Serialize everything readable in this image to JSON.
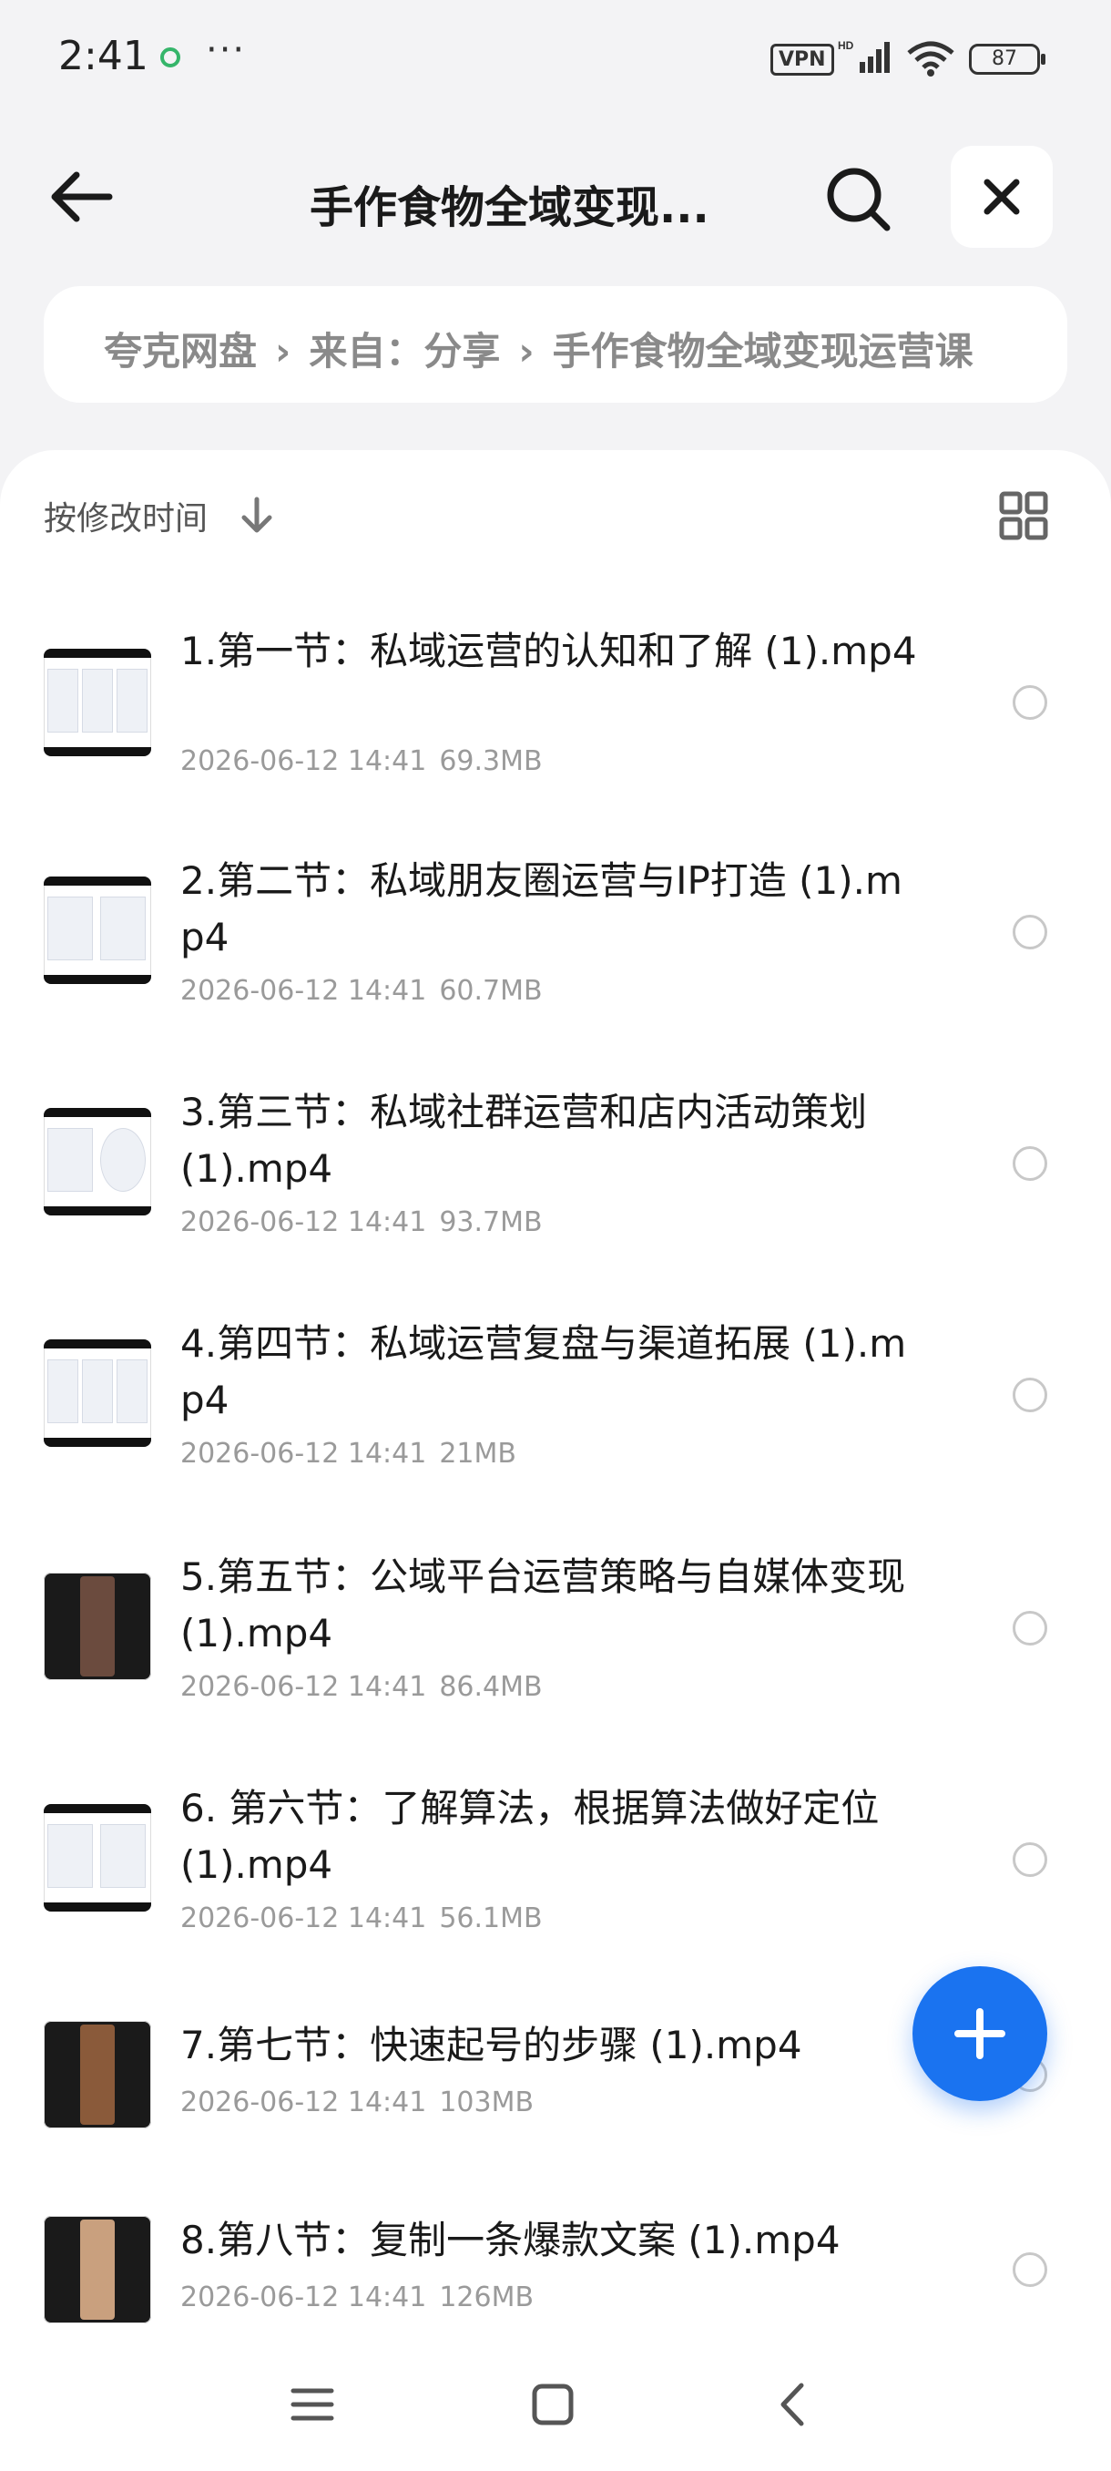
{
  "status_bar": {
    "time": "2:41",
    "more": "···",
    "vpn": "VPN",
    "battery": "87"
  },
  "header": {
    "title": "手作食物全域变现..."
  },
  "breadcrumb": {
    "items": [
      "夸克网盘",
      "来自：分享",
      "手作食物全域变现运营课"
    ]
  },
  "toolbar": {
    "sort_label": "按修改时间"
  },
  "files": [
    {
      "name": "1.第一节：私域运营的认知和了解 (1).mp4",
      "date": "2026-06-12 14:41",
      "size": "69.3MB",
      "thumb": "doc"
    },
    {
      "name": "2.第二节：私域朋友圈运营与IP打造 (1).mp4",
      "date": "2026-06-12 14:41",
      "size": "60.7MB",
      "thumb": "doc"
    },
    {
      "name": "3.第三节：私域社群运营和店内活动策划 (1).mp4",
      "date": "2026-06-12 14:41",
      "size": "93.7MB",
      "thumb": "doc"
    },
    {
      "name": "4.第四节：私域运营复盘与渠道拓展 (1).mp4",
      "date": "2026-06-12 14:41",
      "size": "21MB",
      "thumb": "doc"
    },
    {
      "name": "5.第五节：公域平台运营策略与自媒体变现 (1).mp4",
      "date": "2026-06-12 14:41",
      "size": "86.4MB",
      "thumb": "dark"
    },
    {
      "name": "6. 第六节：了解算法，根据算法做好定位 (1).mp4",
      "date": "2026-06-12 14:41",
      "size": "56.1MB",
      "thumb": "doc"
    },
    {
      "name": "7.第七节：快速起号的步骤 (1).mp4",
      "date": "2026-06-12 14:41",
      "size": "103MB",
      "thumb": "dark"
    },
    {
      "name": "8.第八节：复制一条爆款文案 (1).mp4",
      "date": "2026-06-12 14:41",
      "size": "126MB",
      "thumb": "dark"
    }
  ],
  "colors": {
    "accent": "#1a73f0",
    "background": "#f3f3f5"
  },
  "icons": [
    "back-arrow-icon",
    "search-icon",
    "close-icon",
    "sort-down-icon",
    "grid-view-icon",
    "plus-icon",
    "menu-icon",
    "home-icon",
    "nav-back-icon"
  ]
}
